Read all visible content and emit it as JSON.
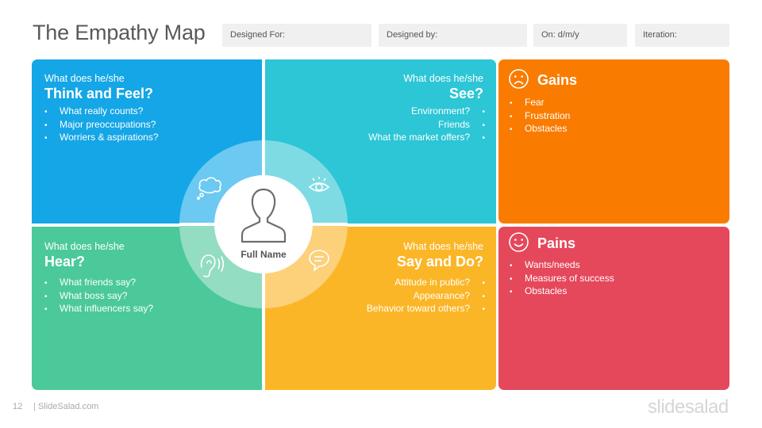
{
  "header": {
    "title": "The Empathy Map",
    "fields": {
      "designed_for": "Designed For:",
      "designed_by": "Designed by:",
      "date": "On: d/m/y",
      "iteration": "Iteration:"
    }
  },
  "quadrants": {
    "think_feel": {
      "sub": "What  does he/she",
      "head": "Think and Feel?",
      "items": [
        "What really counts?",
        "Major preoccupations?",
        "Worriers & aspirations?"
      ]
    },
    "see": {
      "sub": "What  does he/she",
      "head": "See?",
      "items": [
        "Environment?",
        "Friends",
        "What the market offers?"
      ]
    },
    "hear": {
      "sub": "What  does he/she",
      "head": "Hear?",
      "items": [
        "What friends say?",
        "What boss say?",
        "What influencers say?"
      ]
    },
    "say_do": {
      "sub": "What  does he/she",
      "head": "Say and Do?",
      "items": [
        "Attitude in public?",
        "Appearance?",
        "Behavior toward others?"
      ]
    }
  },
  "gains": {
    "head": "Gains",
    "items": [
      "Fear",
      "Frustration",
      "Obstacles"
    ]
  },
  "pains": {
    "head": "Pains",
    "items": [
      "Wants/needs",
      "Measures of success",
      "Obstacles"
    ]
  },
  "center": {
    "label": "Full Name"
  },
  "footer": {
    "page": "12",
    "brand": "| SlideSalad.com",
    "logo": "slidesalad"
  },
  "colors": {
    "think_feel": "#14a6e6",
    "see": "#2cc6d6",
    "hear": "#4bc99a",
    "say_do": "#fbb627",
    "gains": "#f97c00",
    "pains": "#e5485b"
  }
}
